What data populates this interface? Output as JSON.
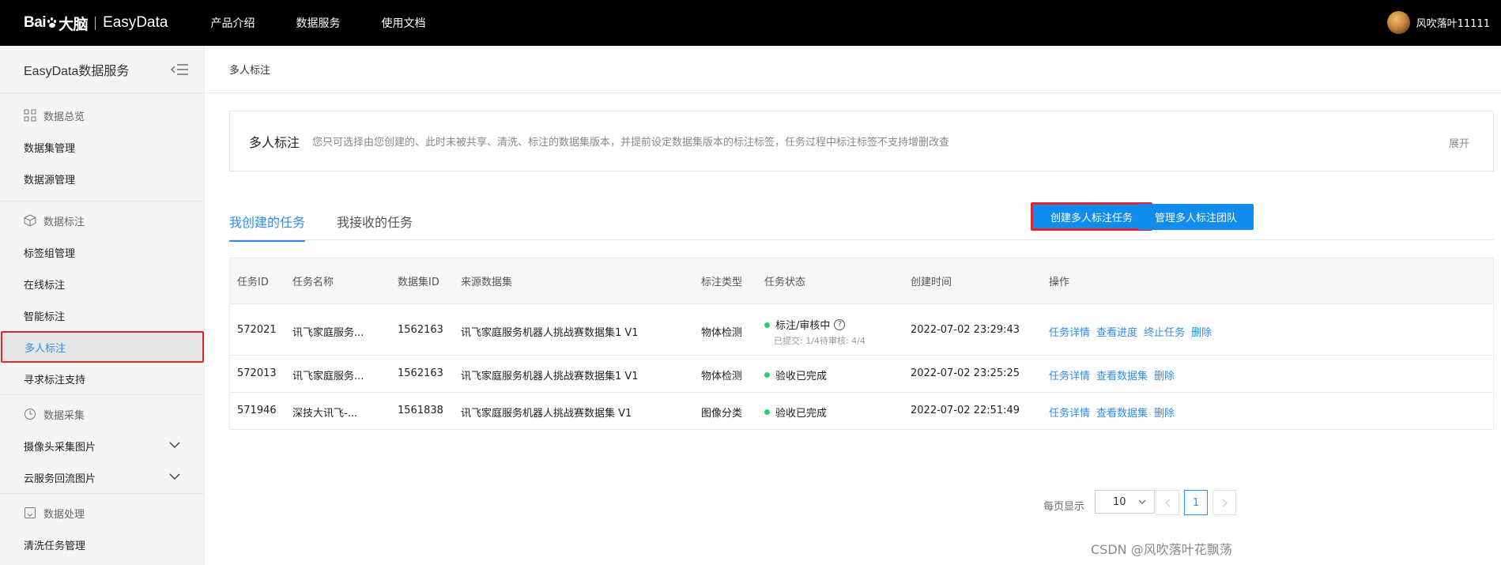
{
  "topbar": {
    "logo_baidu": "Bai",
    "logo_baidu_suffix": "大脑",
    "logo_product": "EasyData",
    "nav": [
      "产品介绍",
      "数据服务",
      "使用文档"
    ],
    "username": "风吹落叶11111"
  },
  "sidebar": {
    "title": "EasyData数据服务",
    "groups": [
      {
        "label": "数据总览",
        "icon": "grid-icon",
        "items": [
          {
            "label": "数据集管理"
          },
          {
            "label": "数据源管理"
          }
        ]
      },
      {
        "label": "数据标注",
        "icon": "cube-icon",
        "items": [
          {
            "label": "标签组管理"
          },
          {
            "label": "在线标注"
          },
          {
            "label": "智能标注"
          },
          {
            "label": "多人标注"
          },
          {
            "label": "寻求标注支持"
          }
        ]
      },
      {
        "label": "数据采集",
        "icon": "clock-icon",
        "items": [
          {
            "label": "摄像头采集图片"
          },
          {
            "label": "云服务回流图片"
          }
        ]
      },
      {
        "label": "数据处理",
        "icon": "process-icon",
        "items": [
          {
            "label": "清洗任务管理"
          }
        ]
      }
    ]
  },
  "main": {
    "breadcrumb": "多人标注",
    "intro": {
      "title": "多人标注",
      "desc": "您只可选择由您创建的、此时未被共享、清洗、标注的数据集版本，并提前设定数据集版本的标注标签，任务过程中标注标签不支持增删改查",
      "expand": "展开"
    },
    "tabs": [
      "我创建的任务",
      "我接收的任务"
    ],
    "buttons": {
      "create": "创建多人标注任务",
      "team": "管理多人标注团队"
    },
    "table": {
      "headers": [
        "任务ID",
        "任务名称",
        "数据集ID",
        "来源数据集",
        "标注类型",
        "任务状态",
        "创建时间",
        "操作"
      ],
      "rows": [
        {
          "id": "572021",
          "name": "讯飞家庭服务...",
          "dataset_id": "1562163",
          "source": "讯飞家庭服务机器人挑战赛数据集1 V1",
          "type": "物体检测",
          "status": "标注/审核中",
          "sub_submitted": "已提交: 1/4",
          "sub_pending": "待审核: 4/4",
          "time": "2022-07-02 23:29:43",
          "ops": [
            "任务详情",
            "查看进度",
            "终止任务",
            "删除"
          ]
        },
        {
          "id": "572013",
          "name": "讯飞家庭服务...",
          "dataset_id": "1562163",
          "source": "讯飞家庭服务机器人挑战赛数据集1 V1",
          "type": "物体检测",
          "status": "验收已完成",
          "time": "2022-07-02 23:25:25",
          "ops": [
            "任务详情",
            "查看数据集",
            "删除"
          ]
        },
        {
          "id": "571946",
          "name": "深技大讯飞-...",
          "dataset_id": "1561838",
          "source": "讯飞家庭服务机器人挑战赛数据集 V1",
          "type": "图像分类",
          "status": "验收已完成",
          "time": "2022-07-02 22:51:49",
          "ops": [
            "任务详情",
            "查看数据集",
            "删除"
          ]
        }
      ]
    },
    "pager": {
      "label": "每页显示",
      "page_size": "10",
      "current": "1"
    }
  },
  "watermark": "CSDN @风吹落叶花飘荡",
  "colors": {
    "accent": "#2d8cf0",
    "button": "#108cee",
    "highlight": "#e0262f",
    "status_dot": "#2ecc71"
  }
}
